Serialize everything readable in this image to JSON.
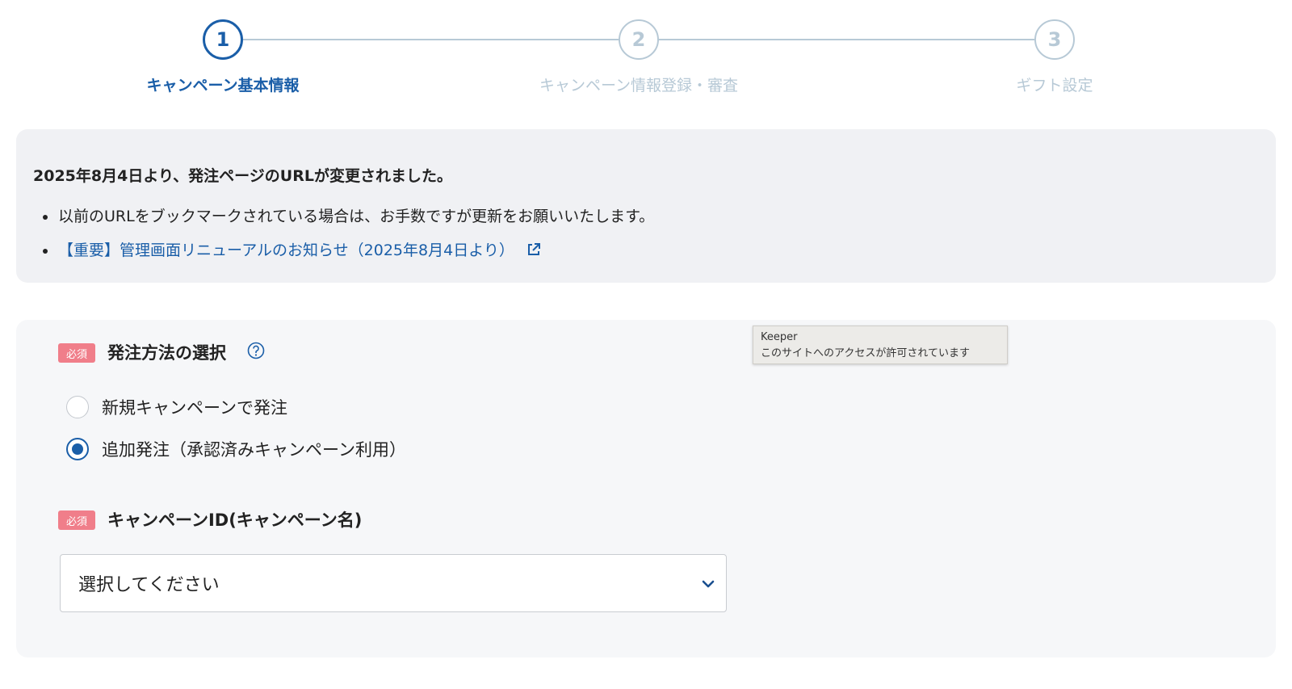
{
  "stepper": {
    "steps": [
      {
        "number": "1",
        "label": "キャンペーン基本情報",
        "active": true
      },
      {
        "number": "2",
        "label": "キャンペーン情報登録・審査",
        "active": false
      },
      {
        "number": "3",
        "label": "ギフト設定",
        "active": false
      }
    ]
  },
  "notice": {
    "title": "2025年8月4日より、発注ページのURLが変更されました。",
    "items": [
      "以前のURLをブックマークされている場合は、お手数ですが更新をお願いいたします。"
    ],
    "link_text": "【重要】管理画面リニューアルのお知らせ（2025年8月4日より）"
  },
  "form": {
    "order_method": {
      "badge": "必須",
      "label": "発注方法の選択",
      "options": [
        {
          "label": "新規キャンペーンで発注",
          "checked": false
        },
        {
          "label": "追加発注（承認済みキャンペーン利用）",
          "checked": true
        }
      ]
    },
    "campaign_id": {
      "badge": "必須",
      "label": "キャンペーンID(キャンペーン名)",
      "select_value": "選択してください"
    }
  },
  "tooltip": {
    "title": "Keeper",
    "text": "このサイトへのアクセスが許可されています"
  },
  "colors": {
    "primary": "#1a5ea8",
    "inactive": "#b7c9d6",
    "required_badge": "#f07e8a",
    "notice_bg": "#f0f1f4"
  }
}
